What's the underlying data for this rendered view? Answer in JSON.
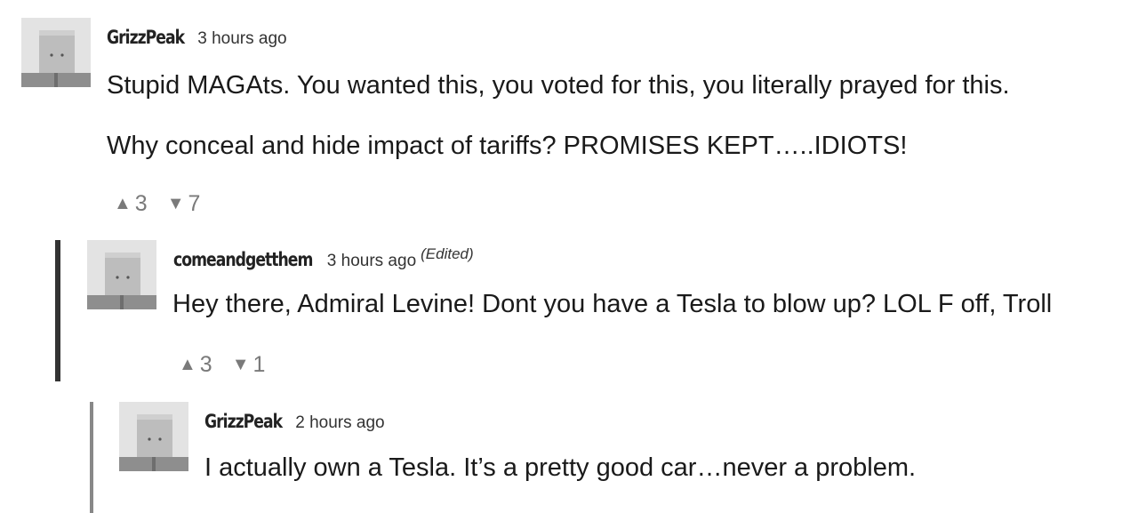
{
  "comments": [
    {
      "username": "GrizzPeak",
      "time": "3 hours ago",
      "edited": "",
      "paragraphs": [
        "Stupid MAGAts.  You wanted this, you voted for this, you literally prayed for this.",
        "Why conceal and hide impact of tariffs?  PROMISES KEPT…..IDIOTS!"
      ],
      "upvotes": "3",
      "downvotes": "7"
    },
    {
      "username": "comeandgetthem",
      "time": "3 hours ago",
      "edited": "(Edited)",
      "paragraphs": [
        "Hey there, Admiral Levine! Dont you have a Tesla to blow up? LOL F off, Troll"
      ],
      "upvotes": "3",
      "downvotes": "1"
    },
    {
      "username": "GrizzPeak",
      "time": "2 hours ago",
      "edited": "",
      "paragraphs": [
        "I actually own a Tesla.  It’s a pretty good car…never a problem."
      ]
    }
  ],
  "icons": {
    "upvote": "up-triangle-icon",
    "downvote": "down-triangle-icon",
    "avatar": "default-avatar-icon"
  },
  "colors": {
    "thread_bar_dark": "#333333",
    "thread_bar_light": "#888888",
    "vote_gray": "#7a7a7a"
  }
}
